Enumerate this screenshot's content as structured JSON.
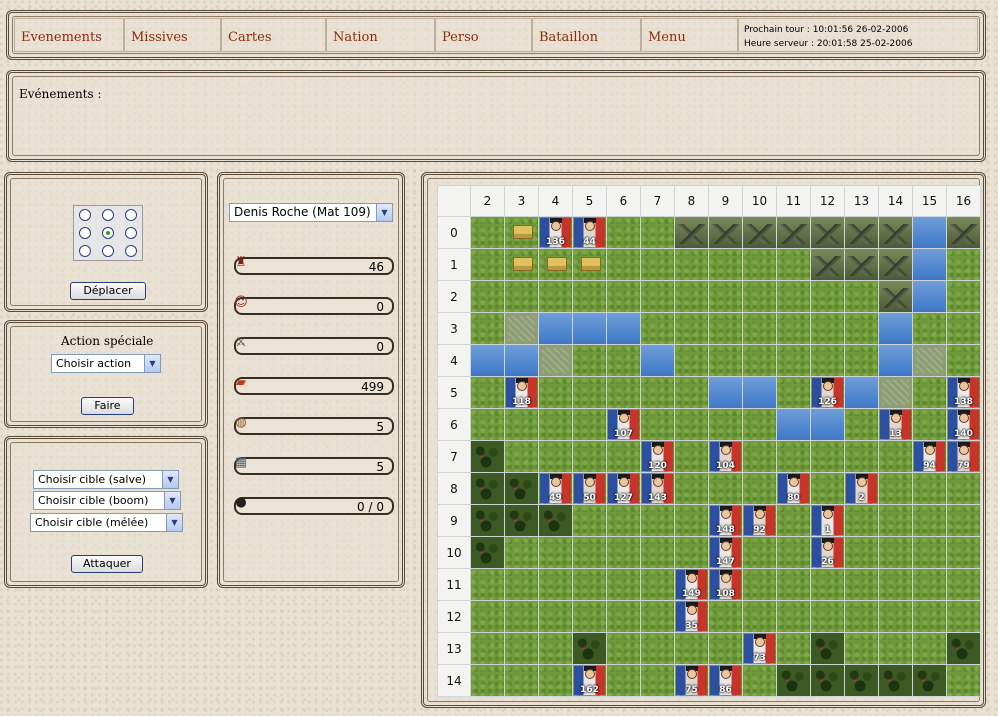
{
  "menu": {
    "items": [
      "Evenements",
      "Missives",
      "Cartes",
      "Nation",
      "Perso",
      "Bataillon",
      "Menu"
    ],
    "next_turn": "Prochain tour : 10:01:56 26-02-2006",
    "server_time": "Heure serveur : 20:01:58 25-02-2006"
  },
  "events": {
    "title": "Evénements :"
  },
  "move": {
    "button": "Déplacer",
    "selected_direction": 4
  },
  "special_action": {
    "label": "Action spéciale",
    "select_value": "Choisir action",
    "button": "Faire"
  },
  "attack": {
    "salve": "Choisir cible (salve)",
    "boom": "Choisir cible (boom)",
    "melee": "Choisir cible (mélée)",
    "button": "Attaquer"
  },
  "stats": {
    "character": "Denis Roche (Mat 109)",
    "rows": [
      {
        "icon": "soldier-shako-icon",
        "value": "46"
      },
      {
        "icon": "officer-portrait-icon",
        "value": "0"
      },
      {
        "icon": "sword-icon",
        "value": "0"
      },
      {
        "icon": "cartridge-icon",
        "value": "499"
      },
      {
        "icon": "drum-icon",
        "value": "5"
      },
      {
        "icon": "supply-crate-icon",
        "value": "5"
      },
      {
        "icon": "artillery-icon",
        "value": "0 / 0"
      }
    ]
  },
  "map": {
    "columns": [
      "2",
      "3",
      "4",
      "5",
      "6",
      "7",
      "8",
      "9",
      "10",
      "11",
      "12",
      "13",
      "14",
      "15",
      "16"
    ],
    "rows": [
      "0",
      "1",
      "2",
      "3",
      "4",
      "5",
      "6",
      "7",
      "8",
      "9",
      "10",
      "11",
      "12",
      "13",
      "14"
    ],
    "grid": [
      "gFUUggMMMMMMMwM",
      "gFFFggggggMMMwg",
      "ggggggggggggMwg",
      "gpwwwgggggggwgg",
      "wwpggwggggggwpg",
      "gUgggggwwgUwpgU",
      "ggggUggggwwgUgU",
      "fggggUgUgggggUU",
      "ffUUUUgggUgUggg",
      "fffggggUUgUgggg",
      "fggggggUggUgggg",
      "ggggggUUggggggg",
      "ggggggUgggggggg",
      "gggfggggUgfgggf",
      "gggUggUUgfffffg"
    ],
    "units": [
      [
        "136",
        "44"
      ],
      [],
      [],
      [],
      [],
      [
        "118",
        "126",
        "138"
      ],
      [
        "107",
        "13",
        "140"
      ],
      [
        "120",
        "104",
        "94",
        "79"
      ],
      [
        "49",
        "50",
        "127",
        "143",
        "80",
        "2"
      ],
      [
        "148",
        "92",
        "1"
      ],
      [
        "147",
        "26"
      ],
      [
        "149",
        "108"
      ],
      [
        "35"
      ],
      [
        "73"
      ],
      [
        "162",
        "75",
        "86"
      ]
    ]
  },
  "colors": {
    "link": "#8a2b10",
    "grass": "#6f9a3a",
    "water": "#4a82cc"
  }
}
